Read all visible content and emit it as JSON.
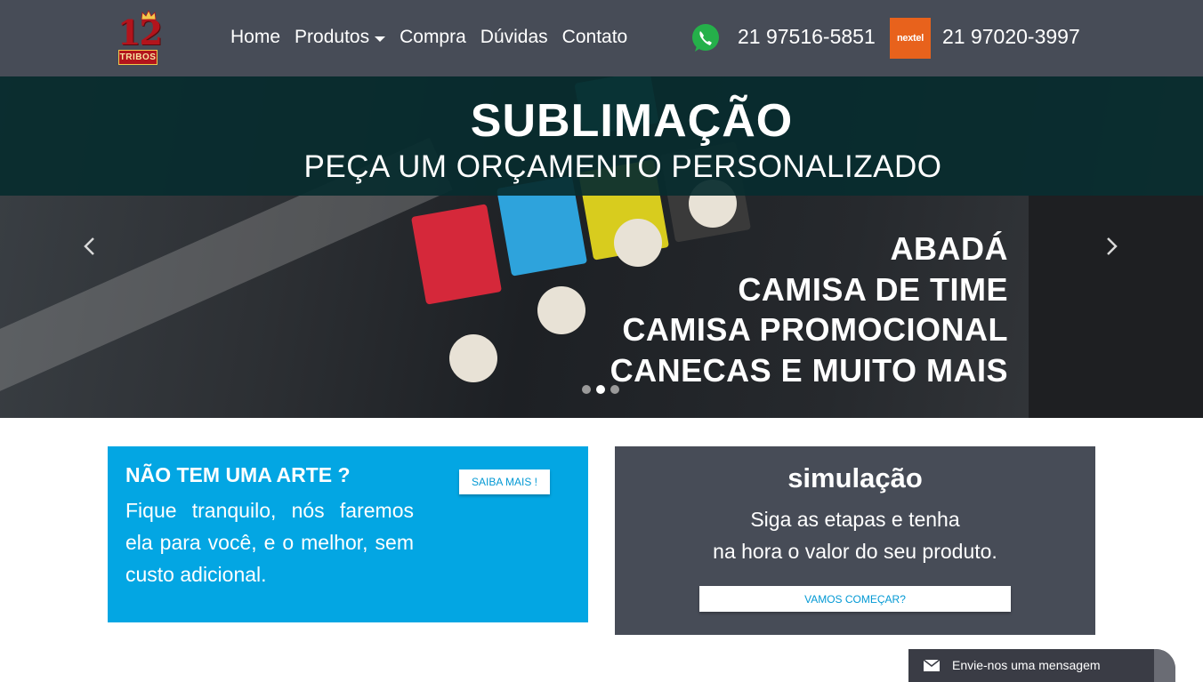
{
  "brand": {
    "logo_number": "12",
    "logo_text": "TRIBOS"
  },
  "nav": {
    "items": [
      "Home",
      "Produtos",
      "Compra",
      "Dúvidas",
      "Contato"
    ]
  },
  "contact": {
    "whatsapp_icon": "whatsapp-icon",
    "phone_whatsapp": "21 97516-5851",
    "nextel_label": "nextel",
    "phone_nextel": "21 97020-3997"
  },
  "carousel": {
    "title": "SUBLIMAÇÃO",
    "subtitle": "PEÇA UM ORÇAMENTO PERSONALIZADO",
    "lines": [
      "ABADÁ",
      "CAMISA DE TIME",
      "CAMISA PROMOCIONAL",
      "CANECAS E MUITO MAIS"
    ],
    "slide_count": 3,
    "active_slide": 2
  },
  "card_art": {
    "heading": "NÃO TEM UMA ARTE ?",
    "text": "Fique tranquilo, nós faremos ela para você, e o melhor, sem custo adicional.",
    "button": "SAIBA MAIS !"
  },
  "card_sim": {
    "heading": "simulação",
    "line1": "Siga as etapas e tenha",
    "line2": "na hora o valor do seu produto.",
    "button": "VAMOS COMEÇAR?"
  },
  "chat": {
    "label": "Envie-nos uma mensagem",
    "icon": "mail-icon"
  },
  "colors": {
    "navbar": "#474c57",
    "accent_blue": "#03a6e3",
    "nextel": "#e8621c",
    "whatsapp": "#25b04a"
  }
}
